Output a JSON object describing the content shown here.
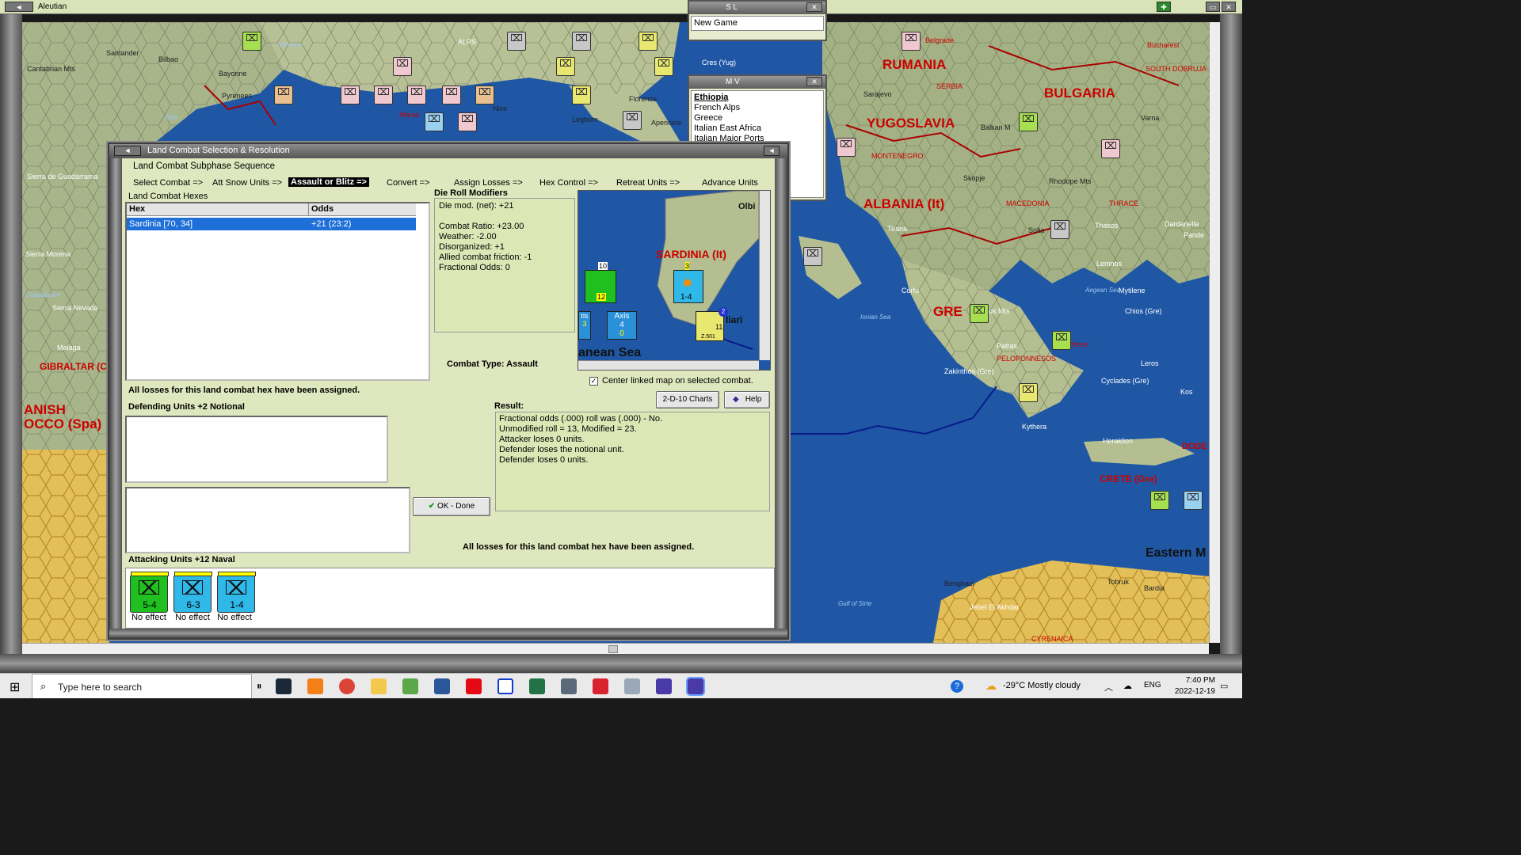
{
  "window": {
    "title": "Aleutian"
  },
  "map": {
    "labels": {
      "rumania": "RUMANIA",
      "bulgaria": "BULGARIA",
      "yugoslavia": "YUGOSLAVIA",
      "albania": "ALBANIA (It)",
      "greece": "GRE",
      "gibraltar": "GIBRALTAR (C",
      "morocco1": "ANISH",
      "morocco2": "OCCO (Spa)",
      "crete": "CRETE (Gre)",
      "eastern": "Eastern M",
      "alps": "ALPS",
      "cantabrian": "Cantabrian Mts",
      "santander": "Santander",
      "bilbao": "Bilbao",
      "bayonne": "Bayonne",
      "pyrenees": "Pyrenees",
      "sierra_guad": "Sierra de Guadarrama",
      "sierra_morena": "Sierra Morena",
      "sierra_nevada": "Sierra Nevada",
      "malaga": "Malaga",
      "guadalquivir": "Guadalquivir",
      "ebro": "Ebro",
      "garonne": "Garonne",
      "belgrade": "Belgrade",
      "bucharest": "Bucharest",
      "south_dobruja": "SOUTH DOBRUJA",
      "sarajevo": "Sarajevo",
      "serbia": "SERBIA",
      "montenegro": "MONTENEGRO",
      "skopje": "Skopje",
      "macedonia": "MACEDONIA",
      "thrace": "THRACE",
      "tirana": "Tirana",
      "rhodope": "Rhodope Mts",
      "balkan": "Balkan M",
      "varna": "Varna",
      "sofia": "Sofia",
      "corfu": "Corfu",
      "ionian": "Ionian Sea",
      "aegean": "Aegean Sea",
      "patras": "Patras",
      "athens": "Athens",
      "peloponnesos": "PELOPONNESOS",
      "kythera": "Kythera",
      "lemnos": "Lemnos",
      "thasos": "Thasos",
      "mytilene": "Mytilene",
      "chios": "Chios (Gre)",
      "zakinthos": "Zakinthos (Gre)",
      "cyclades": "Cyclades (Gre)",
      "leros": "Leros",
      "kos": "Kos",
      "heraklion": "Heraklion",
      "dodec": "DODE",
      "benghazi": "Benghazi",
      "tobruk": "Tobruk",
      "bardia": "Bardia",
      "jebel": "Jebel El Akhdar",
      "cyrenaica": "CYRENAICA",
      "sirte": "Gulf of Sirte",
      "florence": "Florence",
      "leghorn": "Leghorn",
      "apennine": "Apennine",
      "nice": "Nice",
      "marseille": "Marse",
      "pindus": "Pindus Mts",
      "dardanelles": "Dardanelle",
      "pande": "Pande",
      "cres": "Cres (Yug)"
    }
  },
  "sl_panel": {
    "title": "S L",
    "close": "✕",
    "item": "New Game"
  },
  "mv_panel": {
    "title": "M V",
    "close": "✕",
    "items": [
      "Ethiopia",
      "French Alps",
      "Greece",
      "Italian East Africa",
      "Italian Major Ports"
    ]
  },
  "dialog": {
    "title": "Land Combat Selection & Resolution",
    "subphase_label": "Land Combat Subphase Sequence",
    "sequence": [
      "Select Combat =>",
      "Att Snow Units =>",
      "Assault or Blitz =>",
      "Convert =>",
      "Assign Losses =>",
      "Hex Control =>",
      "Retreat Units =>",
      "Advance Units"
    ],
    "hexes_label": "Land Combat Hexes",
    "hex_col": "Hex",
    "odds_col": "Odds",
    "hex_rows": [
      {
        "hex": "Sardinia [70, 34]",
        "odds": "+21 (23:2)"
      }
    ],
    "drm_label": "Die Roll Modifiers",
    "drm": [
      "Die mod. (net): +21",
      "",
      "Combat Ratio: +23.00",
      "Weather: -2.00",
      "Disorganized: +1",
      "Allied combat friction: -1",
      "Fractional Odds: 0"
    ],
    "combat_type": "Combat Type:  Assault",
    "center_linked": "Center linked map on selected combat.",
    "losses_assigned_1": "All losses for this land combat hex have been assigned.",
    "defending_label": "Defending Units +2 Notional",
    "charts_btn": "2-D-10 Charts",
    "help_btn": "Help",
    "result_label": "Result:",
    "result_lines": [
      "Fractional odds (.000) roll was (.000)  - No.",
      "Unmodified roll = 13, Modified = 23.",
      "Attacker loses 0 units.",
      "Defender loses the notional unit.",
      "Defender loses 0 units."
    ],
    "ok_btn": "OK - Done",
    "losses_assigned_2": "All losses for this land combat hex have been assigned.",
    "attacking_label": "Attacking Units +12 Naval",
    "attacking_units": [
      {
        "strength": "5-4",
        "effect": "No effect",
        "color": "#20c020"
      },
      {
        "strength": "6-3",
        "effect": "No effect",
        "color": "#30b8e8"
      },
      {
        "strength": "1-4",
        "effect": "No effect",
        "color": "#30b8e8"
      }
    ],
    "minimap": {
      "sardinia": "SARDINIA (It)",
      "olbia": "Olbi",
      "cagliari": "liari",
      "sea": "anean Sea",
      "axis": "Axis",
      "axis_val": "4",
      "axis_sub": "0",
      "unit_str": "1-4",
      "unit_top": "3",
      "stack_top": "10",
      "stack_bot": "12",
      "air_top": "2",
      "air_bot": "11",
      "air_name": "Z.501",
      "left_frag": "tis",
      "left_val": "3"
    }
  },
  "taskbar": {
    "search_placeholder": "Type here to search",
    "weather": "-29°C  Mostly cloudy",
    "lang": "ENG",
    "time": "7:40 PM",
    "date": "2022-12-19"
  }
}
